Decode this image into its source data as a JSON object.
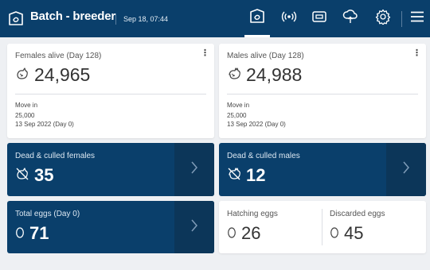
{
  "header": {
    "title": "Batch - breeder",
    "date": "Sep 18, 07:44",
    "tabs": [
      {
        "icon": "batch-icon",
        "active": true
      },
      {
        "icon": "sensor-signal-icon",
        "active": false
      },
      {
        "icon": "device-icon",
        "active": false
      },
      {
        "icon": "cloud-upload-icon",
        "active": false
      },
      {
        "icon": "gear-icon",
        "active": false
      }
    ],
    "menu_icon": "hamburger-icon"
  },
  "females": {
    "label": "Females alive (Day 128)",
    "value": "24,965",
    "move_in_label": "Move in",
    "move_in_value": "25,000",
    "move_in_date": "13 Sep 2022 (Day 0)",
    "menu_glyph": "⋮"
  },
  "males": {
    "label": "Males alive (Day 128)",
    "value": "24,988",
    "move_in_label": "Move in",
    "move_in_value": "25,000",
    "move_in_date": "13 Sep 2022 (Day 0)",
    "menu_glyph": "⋮"
  },
  "dead_females": {
    "label": "Dead & culled females",
    "value": "35"
  },
  "dead_males": {
    "label": "Dead & culled males",
    "value": "12"
  },
  "total_eggs": {
    "label": "Total eggs (Day 0)",
    "value": "71"
  },
  "hatching_eggs": {
    "label": "Hatching eggs",
    "value": "26"
  },
  "discarded_eggs": {
    "label": "Discarded eggs",
    "value": "45"
  },
  "colors": {
    "primary": "#0a3f6b",
    "arrow_panel": "#0c3659",
    "background": "#eef0f3"
  }
}
